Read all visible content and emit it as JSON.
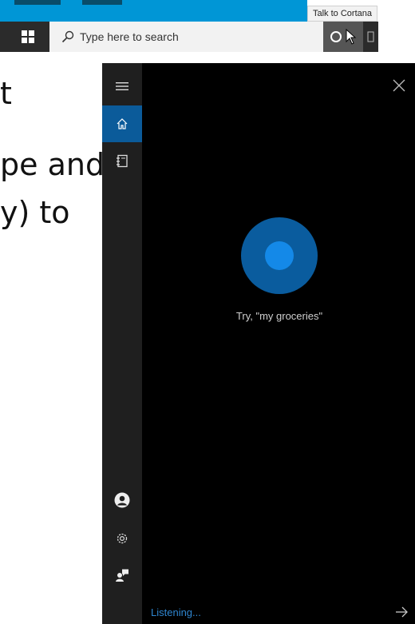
{
  "tooltip": {
    "text": "Talk to Cortana"
  },
  "taskbar": {
    "search_placeholder": "Type here to search"
  },
  "background_text": {
    "line1": "t",
    "line2": "pe and",
    "line3": "y) to"
  },
  "cortana": {
    "suggestion": "Try, \"my groceries\"",
    "status": "Listening..."
  },
  "colors": {
    "accent": "#0b5b9a",
    "orb_outer": "#0a5c9e",
    "orb_inner": "#1489e8",
    "taskbar": "#2b2b2b",
    "status_text": "#2f86d0"
  },
  "icons": {
    "start": "windows-logo-icon",
    "search": "search-icon",
    "cortana": "cortana-circle-icon",
    "task_view": "task-view-icon",
    "menu": "hamburger-menu-icon",
    "home": "home-icon",
    "notebook": "notebook-icon",
    "account": "account-icon",
    "settings": "gear-icon",
    "feedback": "feedback-icon",
    "close": "close-icon",
    "submit": "arrow-right-icon",
    "pointer": "mouse-cursor-icon"
  }
}
